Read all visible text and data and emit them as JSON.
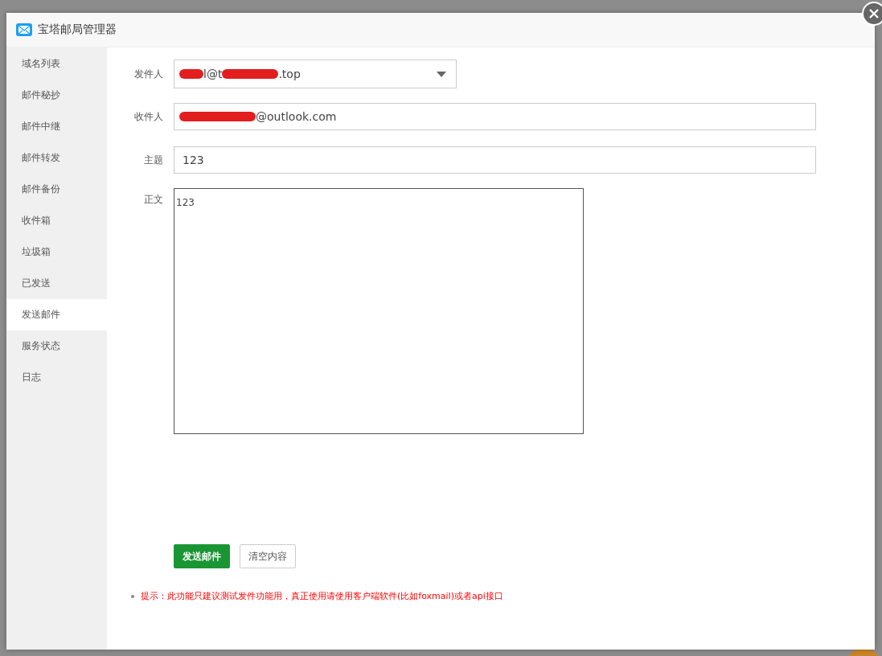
{
  "window": {
    "title": "宝塔邮局管理器"
  },
  "sidebar": {
    "items": [
      {
        "label": "域名列表",
        "selected": false
      },
      {
        "label": "邮件秘抄",
        "selected": false
      },
      {
        "label": "邮件中继",
        "selected": false
      },
      {
        "label": "邮件转发",
        "selected": false
      },
      {
        "label": "邮件备份",
        "selected": false
      },
      {
        "label": "收件箱",
        "selected": false
      },
      {
        "label": "垃圾箱",
        "selected": false
      },
      {
        "label": "已发送",
        "selected": false
      },
      {
        "label": "发送邮件",
        "selected": true
      },
      {
        "label": "服务状态",
        "selected": false
      },
      {
        "label": "日志",
        "selected": false
      }
    ]
  },
  "form": {
    "sender": {
      "label": "发件人",
      "segments": [
        {
          "kind": "redaction"
        },
        {
          "kind": "text",
          "text": "l@t"
        },
        {
          "kind": "redaction"
        },
        {
          "kind": "text",
          "text": ".top"
        }
      ]
    },
    "recipient": {
      "label": "收件人",
      "segments": [
        {
          "kind": "redaction"
        },
        {
          "kind": "text",
          "text": "@outlook.com"
        }
      ]
    },
    "subject": {
      "label": "主题",
      "value": "123"
    },
    "body": {
      "label": "正文",
      "value": "123"
    }
  },
  "buttons": [
    {
      "label": "发送邮件",
      "kind": "primary"
    },
    {
      "label": "清空内容",
      "kind": "default"
    }
  ],
  "tip": "提示：此功能只建议测试发件功能用，真正使用请使用客户端软件(比如foxmail)或者api接口"
}
